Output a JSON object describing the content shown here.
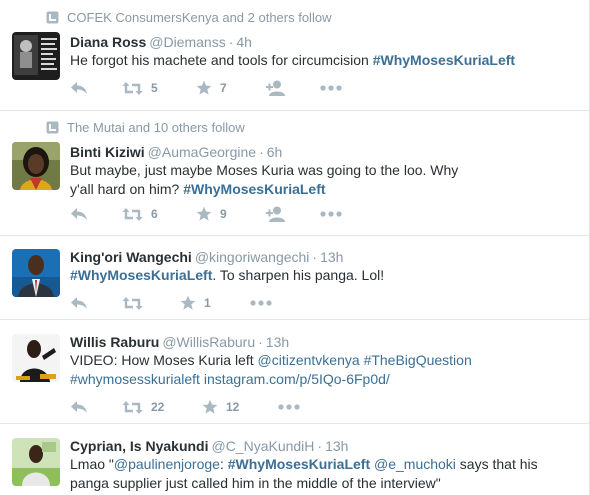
{
  "colors": {
    "text": "#292f33",
    "meta": "#8899a6",
    "link": "#3b6f95",
    "icon": "#aab8c2",
    "divider": "#e1e8ed"
  },
  "tweets": [
    {
      "context": "COFEK ConsumersKenya and 2 others follow",
      "fullname": "Diana Ross",
      "username": "@Diemanss",
      "dot": "·",
      "time": "4h",
      "text": "He forgot his machete and tools for circumcision  ",
      "hashtag": "#WhyMosesKuriaLeft",
      "retweets": "5",
      "likes": "7"
    },
    {
      "context": "The Mutai and 10 others follow",
      "fullname": "Binti Kiziwi",
      "username": "@AumaGeorgine",
      "dot": "·",
      "time": "6h",
      "text": "But maybe, just maybe Moses Kuria was going to the loo. Why y'all hard on him? ",
      "hashtag": "#WhyMosesKuriaLeft",
      "retweets": "6",
      "likes": "9"
    },
    {
      "fullname": "King'ori Wangechi",
      "username": "@kingoriwangechi",
      "dot": "·",
      "time": "13h",
      "hashtag": "#WhyMosesKuriaLeft",
      "text": ". To sharpen his panga.  Lol!",
      "likes": "1"
    },
    {
      "fullname": "Willis Raburu",
      "username": "@WillisRaburu",
      "dot": "·",
      "time": "13h",
      "text": "VIDEO: How Moses Kuria left ",
      "mention": "@citizentvkenya",
      "hashtag_1": "#TheBigQuestion",
      "hashtag_2": "#whymosesskurialeft",
      "url": "instagram.com/p/5IQo-6Fp0d/",
      "retweets": "22",
      "likes": "12"
    },
    {
      "fullname": "Cyprian, Is Nyakundi",
      "username": "@C_NyaKundiH",
      "dot": "·",
      "time": "13h",
      "text_1": "Lmao  \"",
      "mention_1": "@paulinenjoroge",
      "text_2": ": ",
      "hashtag": "#WhyMosesKuriaLeft",
      "mention_2": "@e_muchoki",
      "text_3": " says that his",
      "text_4": "panga supplier just called him in the middle of the interview\""
    }
  ]
}
